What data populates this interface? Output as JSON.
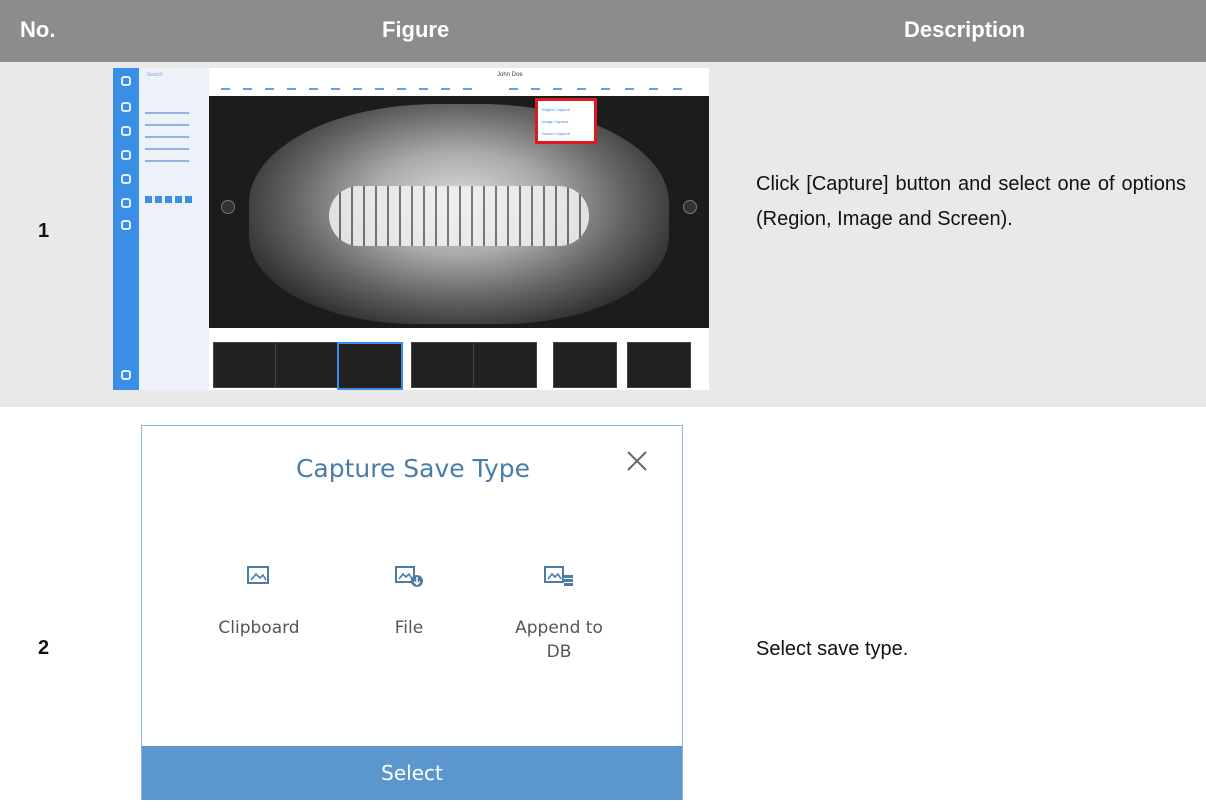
{
  "header": {
    "col_no": "No.",
    "col_figure": "Figure",
    "col_description": "Description"
  },
  "rows": [
    {
      "no": "1",
      "description": "Click [Capture] button and select one of options (Region, Image and Screen).",
      "figure": {
        "search_placeholder": "Search",
        "window_title": "John Doe",
        "capture_menu": [
          "Region Capture",
          "Image Capture",
          "Screen Capture"
        ]
      }
    },
    {
      "no": "2",
      "description": "Select save type.",
      "figure": {
        "dialog_title": "Capture Save Type",
        "options": [
          {
            "label": "Clipboard",
            "icon": "clipboard-image-icon"
          },
          {
            "label": "File",
            "icon": "file-download-image-icon"
          },
          {
            "label": "Append to DB",
            "icon": "append-db-image-icon"
          }
        ],
        "select_label": "Select"
      }
    }
  ],
  "colors": {
    "header_bg": "#8c8c8c",
    "row_alt_bg": "#e9e9e9",
    "accent": "#3a8ee6",
    "highlight": "#e0191f",
    "button": "#5b97cc"
  }
}
